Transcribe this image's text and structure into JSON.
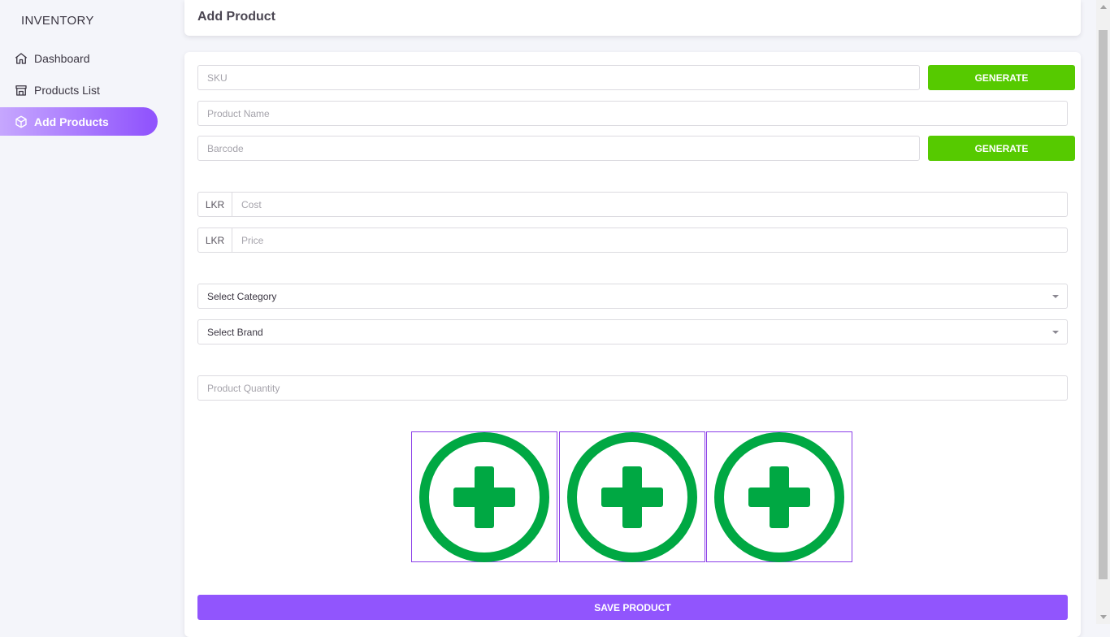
{
  "sidebar": {
    "brand": "INVENTORY",
    "items": [
      {
        "label": "Dashboard",
        "icon": "home-icon"
      },
      {
        "label": "Products List",
        "icon": "store-icon"
      },
      {
        "label": "Add Products",
        "icon": "cube-icon",
        "active": true
      }
    ]
  },
  "header": {
    "title": "Add Product"
  },
  "form": {
    "sku": {
      "placeholder": "SKU"
    },
    "generate_label": "GENERATE",
    "product_name": {
      "placeholder": "Product Name"
    },
    "barcode": {
      "placeholder": "Barcode"
    },
    "currency": "LKR",
    "cost": {
      "placeholder": "Cost"
    },
    "price": {
      "placeholder": "Price"
    },
    "category": {
      "selected": "Select Category"
    },
    "brand": {
      "selected": "Select Brand"
    },
    "quantity": {
      "placeholder": "Product Quantity"
    },
    "image_slots": [
      {
        "icon": "add-image-icon"
      },
      {
        "icon": "add-image-icon"
      },
      {
        "icon": "add-image-icon"
      }
    ],
    "save_label": "SAVE PRODUCT"
  },
  "colors": {
    "primary": "#9155fd",
    "generate": "#56ca00",
    "add_icon": "#00a843"
  }
}
